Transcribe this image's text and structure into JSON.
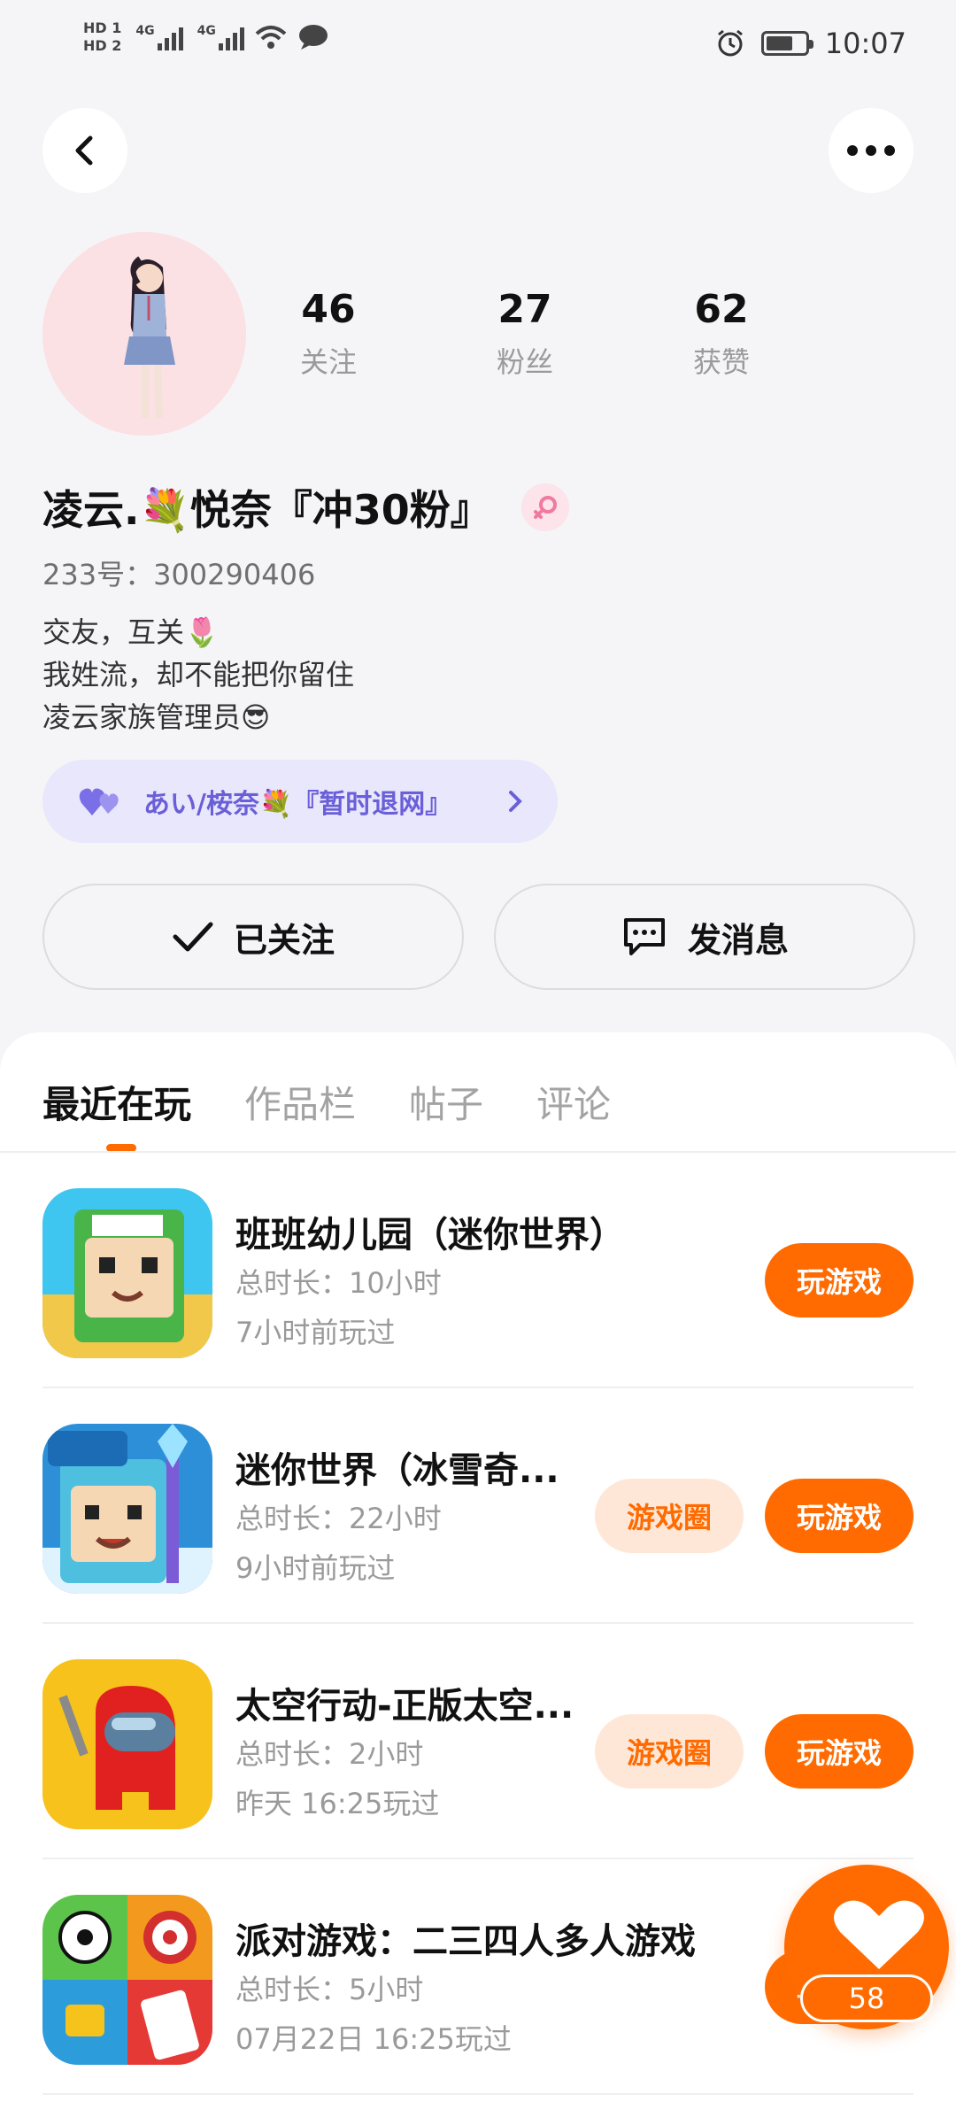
{
  "status_bar": {
    "hd1": "HD 1",
    "hd2": "HD 2",
    "network1": "4G",
    "network2": "4G",
    "time": "10:07"
  },
  "profile": {
    "stats": [
      {
        "value": "46",
        "label": "关注"
      },
      {
        "value": "27",
        "label": "粉丝"
      },
      {
        "value": "62",
        "label": "获赞"
      }
    ],
    "nickname": "凌云.💐悦奈『冲30粉』",
    "uid": "233号：300290406",
    "bio": [
      "交友，互关🌷",
      "我姓流，却不能把你留住",
      "凌云家族管理员😎"
    ],
    "family": "あい/桉奈💐『暂时退网』"
  },
  "actions": {
    "follow_label": "已关注",
    "message_label": "发消息"
  },
  "tabs": [
    "最近在玩",
    "作品栏",
    "帖子",
    "评论"
  ],
  "games": [
    {
      "title": "班班幼儿园（迷你世界）",
      "duration": "总时长：10小时",
      "last_played": "7小时前玩过",
      "has_circle": false
    },
    {
      "title": "迷你世界（冰雪奇...",
      "duration": "总时长：22小时",
      "last_played": "9小时前玩过",
      "has_circle": true
    },
    {
      "title": "太空行动-正版太空...",
      "duration": "总时长：2小时",
      "last_played": "昨天 16:25玩过",
      "has_circle": true
    },
    {
      "title": "派对游戏：二三四人多人游戏",
      "duration": "总时长：5小时",
      "last_played": "07月22日 16:25玩过",
      "has_circle": false
    }
  ],
  "buttons": {
    "play": "玩游戏",
    "circle": "游戏圈"
  },
  "like": {
    "count": "58"
  },
  "colors": {
    "accent": "#ff6b00",
    "family_pill": "#e8e7fb",
    "family_text": "#6a5fd8"
  }
}
